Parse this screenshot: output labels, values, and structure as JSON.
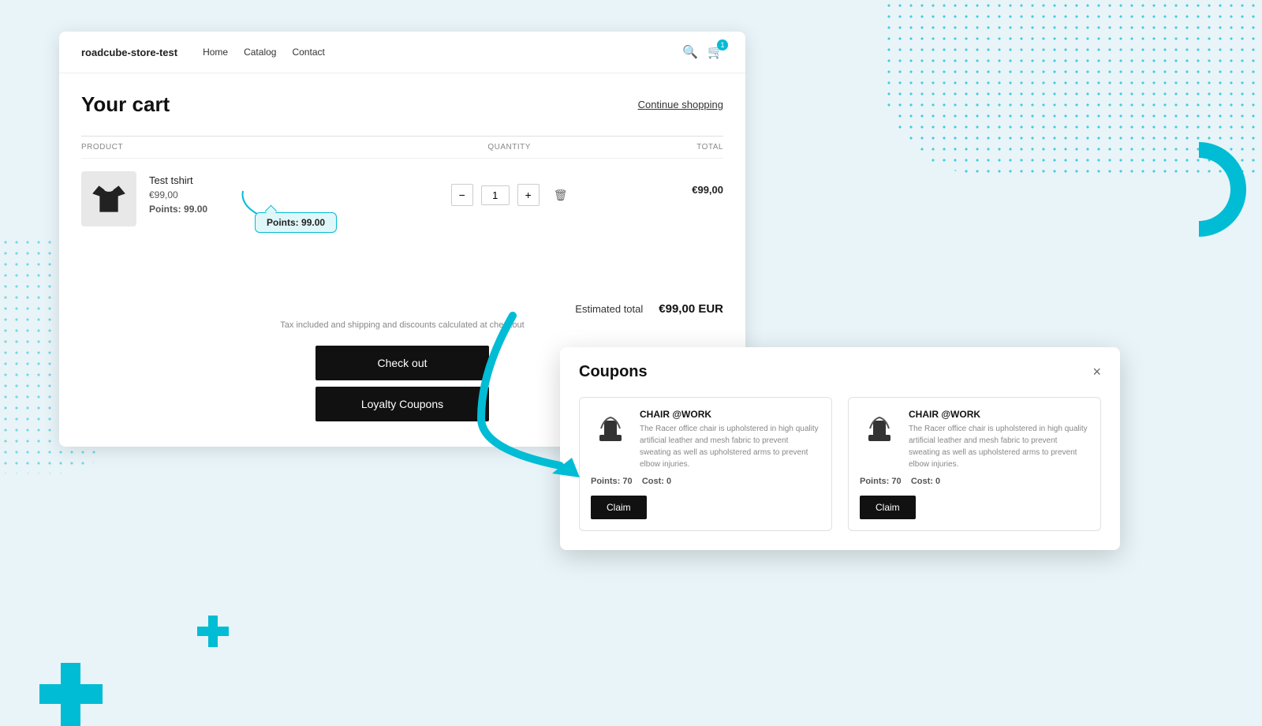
{
  "background": {
    "accent_color": "#00bcd4"
  },
  "nav": {
    "logo": "roadcube-store-test",
    "links": [
      "Home",
      "Catalog",
      "Contact"
    ],
    "cart_count": "1"
  },
  "cart": {
    "title": "Your cart",
    "continue_shopping": "Continue shopping",
    "columns": {
      "product": "PRODUCT",
      "quantity": "QUANTITY",
      "total": "TOTAL"
    },
    "item": {
      "name": "Test tshirt",
      "price": "€99,00",
      "points_label": "Points:",
      "points_value": "99.00",
      "quantity": "1",
      "total": "€99,00"
    },
    "callout": {
      "label": "Points:",
      "value": "99.00"
    },
    "summary": {
      "estimated_label": "Estimated total",
      "estimated_value": "€99,00 EUR",
      "tax_note": "Tax included and shipping and discounts calculated at checkout"
    },
    "checkout_label": "Check out",
    "loyalty_coupons_label": "Loyalty Coupons"
  },
  "coupons_modal": {
    "title": "Coupons",
    "close": "×",
    "items": [
      {
        "name": "CHAIR @WORK",
        "description": "The Racer office chair is upholstered in high quality artificial leather and mesh fabric to prevent sweating as well as upholstered arms to prevent elbow injuries.",
        "points_label": "Points:",
        "points_value": "70",
        "cost_label": "Cost:",
        "cost_value": "0",
        "claim_label": "Claim"
      },
      {
        "name": "CHAIR @WORK",
        "description": "The Racer office chair is upholstered in high quality artificial leather and mesh fabric to prevent sweating as well as upholstered arms to prevent elbow injuries.",
        "points_label": "Points:",
        "points_value": "70",
        "cost_label": "Cost:",
        "cost_value": "0",
        "claim_label": "Claim"
      }
    ]
  }
}
